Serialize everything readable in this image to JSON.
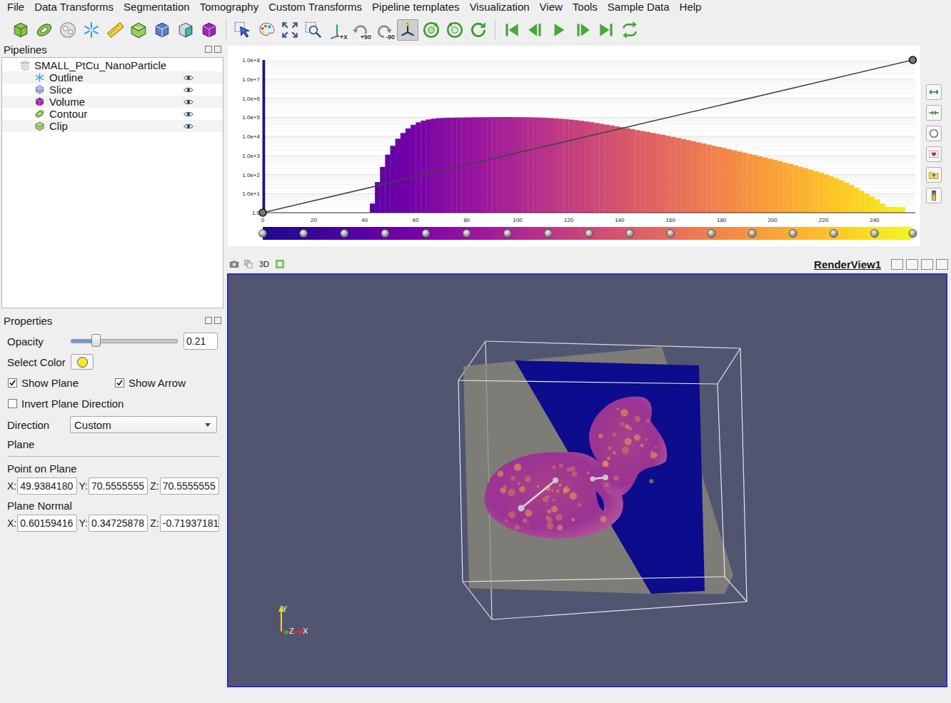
{
  "menu": [
    "File",
    "Data Transforms",
    "Segmentation",
    "Tomography",
    "Custom Transforms",
    "Pipeline templates",
    "Visualization",
    "View",
    "Tools",
    "Sample Data",
    "Help"
  ],
  "toolbar": [
    [
      {
        "kind": "data-source",
        "selected": false
      },
      {
        "kind": "contour",
        "selected": false
      },
      {
        "kind": "threshold",
        "selected": false
      },
      {
        "kind": "slice",
        "selected": false
      },
      {
        "kind": "ruler",
        "selected": false
      },
      {
        "kind": "clip",
        "selected": false
      },
      {
        "kind": "volume",
        "selected": false
      },
      {
        "kind": "segment",
        "selected": false
      },
      {
        "kind": "volume-box",
        "selected": false
      }
    ],
    [
      {
        "kind": "pick",
        "selected": false
      },
      {
        "kind": "colormap",
        "selected": false
      },
      {
        "kind": "reset-camera",
        "selected": false
      },
      {
        "kind": "zoom-box",
        "selected": false
      },
      {
        "kind": "view-axis",
        "label": "+X",
        "selected": false
      },
      {
        "kind": "rotate-cw",
        "label": "+90",
        "selected": false
      },
      {
        "kind": "rotate-ccw",
        "label": "-90",
        "selected": false
      },
      {
        "kind": "interact",
        "selected": true
      },
      {
        "kind": "reset-rotation",
        "selected": false
      },
      {
        "kind": "rotate-view",
        "selected": false
      },
      {
        "kind": "reload",
        "selected": false
      }
    ],
    [
      {
        "kind": "first",
        "selected": false
      },
      {
        "kind": "prev",
        "selected": false
      },
      {
        "kind": "play",
        "selected": false
      },
      {
        "kind": "next",
        "selected": false
      },
      {
        "kind": "last",
        "selected": false
      },
      {
        "kind": "loop",
        "selected": false
      }
    ]
  ],
  "pipelines": {
    "title": "Pipelines",
    "root": {
      "label": "SMALL_PtCu_NanoParticle"
    },
    "items": [
      {
        "label": "Outline",
        "kind": "outline",
        "visible": true
      },
      {
        "label": "Slice",
        "kind": "slice",
        "visible": true
      },
      {
        "label": "Volume",
        "kind": "volume",
        "visible": true
      },
      {
        "label": "Contour",
        "kind": "contour",
        "visible": true
      },
      {
        "label": "Clip",
        "kind": "clip",
        "visible": true
      }
    ]
  },
  "histogram": {
    "y_ticks": [
      "1.0e+8",
      "1.0e+7",
      "1.0e+6",
      "1.0e+5",
      "1.0e+4",
      "1.0e+3",
      "1.0e+2",
      "1.0e+1",
      "1.0"
    ],
    "x_ticks": [
      "0",
      "20",
      "40",
      "60",
      "80",
      "100",
      "120",
      "140",
      "160",
      "180",
      "200",
      "220",
      "240"
    ],
    "bin_width": 2,
    "counts": [
      100000000,
      0,
      0,
      0,
      0,
      0,
      0,
      0,
      0,
      0,
      0,
      0,
      0,
      0,
      0,
      0,
      0,
      0,
      0,
      0,
      0,
      3,
      40,
      250,
      1100,
      3200,
      7500,
      15000,
      26000,
      40000,
      54000,
      66000,
      76000,
      84000,
      89000,
      92000,
      94000,
      95000,
      96000,
      97000,
      98000,
      99000,
      100000,
      100000,
      101000,
      101000,
      102000,
      102000,
      102000,
      101000,
      101000,
      100000,
      99000,
      97000,
      95000,
      93000,
      90000,
      87000,
      83000,
      79000,
      75000,
      70000,
      65000,
      60000,
      55000,
      50000,
      45000,
      41000,
      37000,
      33000,
      30000,
      27000,
      24000,
      21000,
      19000,
      17000,
      15000,
      13500,
      12000,
      10500,
      9300,
      8200,
      7200,
      6300,
      5500,
      4800,
      4200,
      3700,
      3200,
      2800,
      2450,
      2100,
      1850,
      1600,
      1400,
      1200,
      1050,
      900,
      780,
      670,
      580,
      490,
      420,
      360,
      300,
      255,
      215,
      180,
      150,
      125,
      100,
      80,
      64,
      50,
      38,
      28,
      20,
      14,
      10,
      7,
      5,
      3,
      2,
      2,
      2,
      2,
      0,
      0
    ],
    "opacity_points": [
      [
        0,
        0
      ],
      [
        255,
        1
      ]
    ],
    "colormap": [
      "#1e0a8f",
      "#46039f",
      "#7201a8",
      "#9c179e",
      "#bd3786",
      "#d8576b",
      "#ed7953",
      "#fb9f3a",
      "#fdca26",
      "#f0f921"
    ],
    "colormap_points": [
      0,
      16,
      32,
      48,
      64,
      80,
      96,
      112,
      128,
      144,
      160,
      176,
      192,
      208,
      224,
      240,
      255
    ]
  },
  "properties": {
    "title": "Properties",
    "opacity": {
      "label": "Opacity",
      "level": 0.23,
      "value": "0.21"
    },
    "color": {
      "label": "Select Color",
      "color": "#f6e832"
    },
    "checks": [
      {
        "label": "Show Plane",
        "checked": true
      },
      {
        "label": "Show Arrow",
        "checked": true
      },
      {
        "label": "Invert Plane Direction",
        "checked": false
      }
    ],
    "direction": {
      "label": "Direction",
      "value": "Custom"
    },
    "section": "Plane",
    "point": {
      "label": "Point on Plane",
      "fields": [
        {
          "axis": "X:",
          "value": "49.9384180"
        },
        {
          "axis": "Y:",
          "value": "70.5555555"
        },
        {
          "axis": "Z:",
          "value": "70.5555555"
        }
      ]
    },
    "normal": {
      "label": "Plane Normal",
      "fields": [
        {
          "axis": "X:",
          "value": "0.60159416"
        },
        {
          "axis": "Y:",
          "value": "0.34725878"
        },
        {
          "axis": "Z:",
          "value": "-0.71937181"
        }
      ]
    }
  },
  "render_view": {
    "mode": "3D",
    "title": "RenderView1",
    "axes": [
      {
        "label": "Y"
      },
      {
        "label": "Z"
      },
      {
        "label": "X"
      }
    ]
  }
}
